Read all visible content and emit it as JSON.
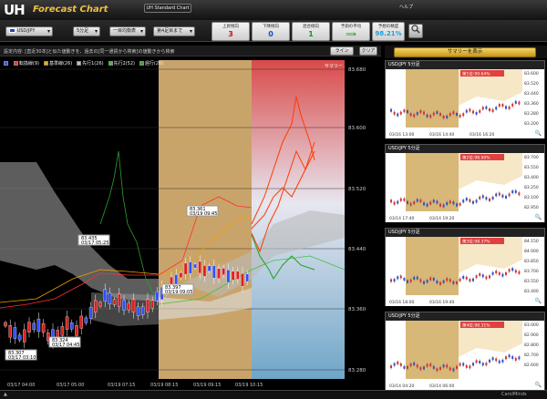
{
  "header": {
    "logo": "UH",
    "logo_sub": "Forecast Chart",
    "standard_chart_label": "UH Standard Chart",
    "help_label": "ヘルプ"
  },
  "toolbar": {
    "pair": "USD/JPY",
    "timeframe": "5分足",
    "period": "一目均衡表",
    "level": "第4足目まで",
    "stats": [
      {
        "label": "上昇傾向",
        "value": "3",
        "color": "#d01010"
      },
      {
        "label": "下降傾向",
        "value": "0",
        "color": "#1050d0"
      },
      {
        "label": "混合傾向",
        "value": "1",
        "color": "#10a010"
      },
      {
        "label": "予測の平均",
        "value": "⟹",
        "color": "#10a010"
      },
      {
        "label": "予想の精度",
        "value": "98.21%",
        "color": "#1aa0e0"
      }
    ]
  },
  "infobar": {
    "text": "設定内容: [直近30本]と似た値動きを、過去の[同一通貨から検索]の値動きから検索",
    "line_label": "ライン",
    "clear_label": "クリア"
  },
  "legend": [
    {
      "label": "転換線(9)",
      "color": "#ff3030"
    },
    {
      "label": "基準線(26)",
      "color": "#f0b000"
    },
    {
      "label": "先行1(26)",
      "color": "#c0c0c0"
    },
    {
      "label": "先行2(52)",
      "color": "#40c040"
    },
    {
      "label": "遅行(26)",
      "color": "#40a040"
    }
  ],
  "summary_label": "サマリー",
  "price_labels": [
    "83.680",
    "83.600",
    "83.520",
    "83.440",
    "83.360",
    "83.280"
  ],
  "annotations": [
    {
      "price": "83.361",
      "time": "03/19 09:45"
    },
    {
      "price": "83.435",
      "time": "03/17 05:25"
    },
    {
      "price": "83.397",
      "time": "03/19 09:05"
    },
    {
      "price": "83.324",
      "time": "03/17 04:45"
    },
    {
      "price": "83.307",
      "time": "03/17 03:10"
    }
  ],
  "x_labels": [
    "03/17 04:00",
    "03/17 05:00",
    "03/19 07:15",
    "03/19 08:15",
    "03/19 09:15",
    "03/19 10:15"
  ],
  "side": {
    "summary_button": "サマリーを表示",
    "panels": [
      {
        "title": "USD/JPY 5分足",
        "rank": "第1位:99.64%",
        "prices": [
          "83.600",
          "83.520",
          "83.440",
          "83.360",
          "83.280",
          "83.200"
        ],
        "x_labels": [
          "03/16 13:00",
          "03/16 14:40",
          "03/16 16:20"
        ]
      },
      {
        "title": "USD/JPY 5分足",
        "rank": "第2位:98.90%",
        "prices": [
          "83.700",
          "83.550",
          "83.400",
          "83.250",
          "83.100",
          "82.950"
        ],
        "x_labels": [
          "03/14 17:40",
          "03/14 19:20"
        ]
      },
      {
        "title": "USD/JPY 5分足",
        "rank": "第3位:98.37%",
        "prices": [
          "84.150",
          "84.000",
          "83.850",
          "83.700",
          "83.550",
          "83.400"
        ],
        "x_labels": [
          "03/16 18:00",
          "03/16 19:40"
        ]
      },
      {
        "title": "USD/JPY 5分足",
        "rank": "第4位:98.31%",
        "prices": [
          "83.000",
          "82.900",
          "82.800",
          "82.700",
          "82.600"
        ],
        "x_labels": [
          "03/14 04:20",
          "03/14 06:00"
        ]
      }
    ]
  },
  "footer": {
    "left": "▲",
    "right": "CarolMinds"
  }
}
